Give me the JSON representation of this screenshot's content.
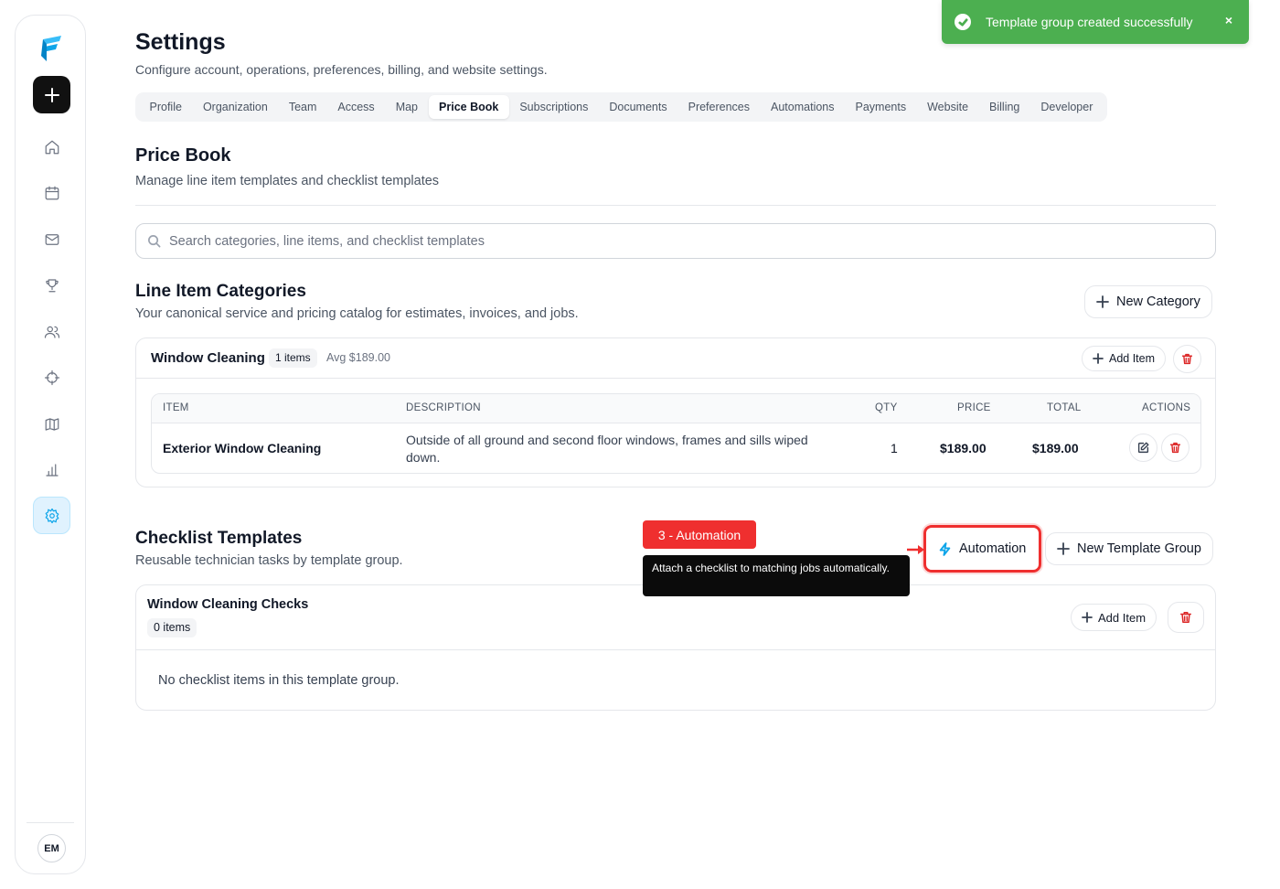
{
  "sidebar": {
    "nav": [
      "home",
      "calendar",
      "mail",
      "trophy",
      "users",
      "crosshair",
      "map",
      "chart",
      "settings"
    ],
    "avatar_initials": "EM"
  },
  "header": {
    "title": "Settings",
    "subtitle": "Configure account, operations, preferences, billing, and website settings."
  },
  "tabs": [
    "Profile",
    "Organization",
    "Team",
    "Access",
    "Map",
    "Price Book",
    "Subscriptions",
    "Documents",
    "Preferences",
    "Automations",
    "Payments",
    "Website",
    "Billing",
    "Developer"
  ],
  "active_tab": "Price Book",
  "price_book": {
    "title": "Price Book",
    "subtitle": "Manage line item templates and checklist templates",
    "search_placeholder": "Search categories, line items, and checklist templates"
  },
  "line_item_categories": {
    "title": "Line Item Categories",
    "subtitle": "Your canonical service and pricing catalog for estimates, invoices, and jobs.",
    "new_category_label": "New Category",
    "categories": [
      {
        "name": "Window Cleaning",
        "count_badge": "1 items",
        "avg": "Avg $189.00",
        "add_item_label": "Add Item",
        "columns": [
          "ITEM",
          "DESCRIPTION",
          "QTY",
          "PRICE",
          "TOTAL",
          "ACTIONS"
        ],
        "rows": [
          {
            "item": "Exterior Window Cleaning",
            "description": "Outside of all ground and second floor windows, frames and sills wiped down.",
            "qty": "1",
            "price": "$189.00",
            "total": "$189.00"
          }
        ]
      }
    ]
  },
  "checklist_templates": {
    "title": "Checklist Templates",
    "subtitle": "Reusable technician tasks by template group.",
    "automation_label": "Automation",
    "new_group_label": "New Template Group",
    "groups": [
      {
        "name": "Window Cleaning Checks",
        "count_badge": "0 items",
        "add_item_label": "Add Item",
        "empty_message": "No checklist items in this template group."
      }
    ]
  },
  "toast": {
    "message": "Template group created successfully",
    "close": "×",
    "color": "#4caf50"
  },
  "annotation": {
    "label": "3 - Automation",
    "tooltip": "Attach a checklist to matching jobs automatically.",
    "color": "#ef2f2f"
  }
}
